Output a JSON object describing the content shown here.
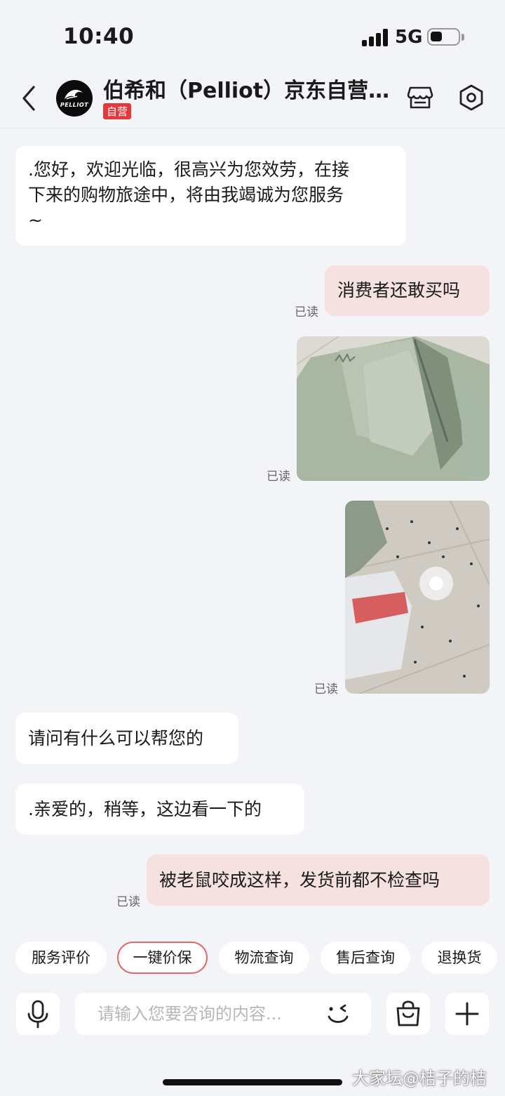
{
  "status_bar": {
    "time": "10:40",
    "network": "5G",
    "battery_level": 0.35,
    "signal_bars": 4
  },
  "header": {
    "back_icon": "chevron-left-icon",
    "avatar_logo": "PELLIOT",
    "title": "伯希和（Pelliot）京东自营…",
    "badge": "自营",
    "store_icon": "store-icon",
    "settings_icon": "settings-icon"
  },
  "messages": [
    {
      "side": "in",
      "lines": [
        ".您好，欢迎光临，很高兴为您效劳，在接",
        "下来的购物旅途中，将由我竭诚为您服务",
        "~"
      ]
    },
    {
      "side": "out",
      "text": "消费者还敢买吗",
      "status": "已读"
    },
    {
      "side": "out",
      "type": "image",
      "description_icon": "photo-icon",
      "status": "已读"
    },
    {
      "side": "out",
      "type": "image",
      "description_icon": "photo-icon",
      "status": "已读"
    },
    {
      "side": "in",
      "text": "请问有什么可以帮您的"
    },
    {
      "side": "in",
      "text": ".亲爱的，稍等，这边看一下的"
    },
    {
      "side": "out",
      "text": "被老鼠咬成这样，发货前都不检查吗",
      "status": "已读"
    }
  ],
  "quick_replies": [
    "服务评价",
    "一键价保",
    "物流查询",
    "售后查询",
    "退换货"
  ],
  "input_bar": {
    "placeholder": "请输入您要咨询的内容...",
    "mic_icon": "microphone-icon",
    "emoji_icon": "emoji-wink-icon",
    "bag_icon": "shopping-bag-icon",
    "plus_icon": "plus-icon"
  },
  "watermark": "大家坛@桔子的桔",
  "colors": {
    "background": "#f3f4f8",
    "outgoing_bubble": "#f5e1df",
    "incoming_bubble": "#ffffff",
    "badge": "#e4393c",
    "active_chip_border": "#e0686a"
  }
}
